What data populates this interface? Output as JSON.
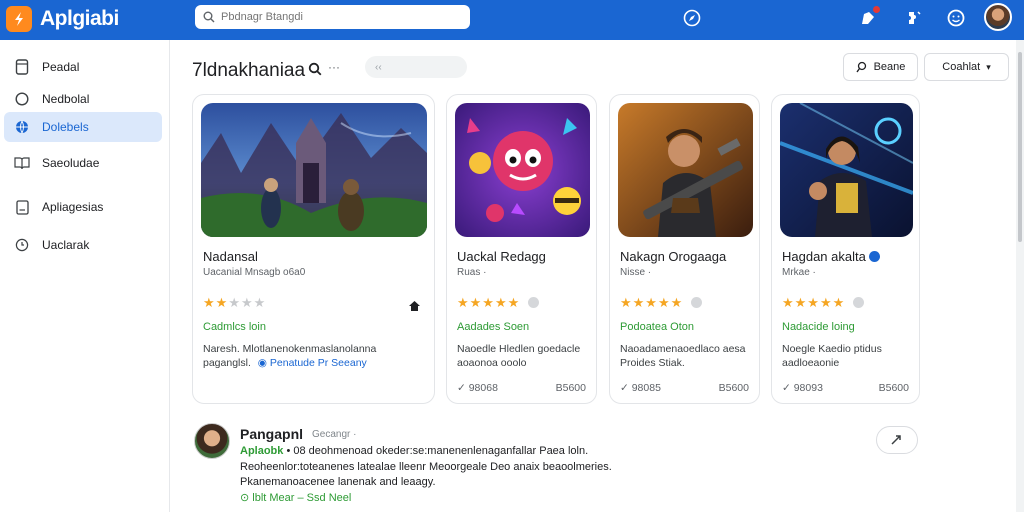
{
  "app": {
    "name": "Aplgiabi"
  },
  "search": {
    "placeholder": "Pbdnagr Btangdi"
  },
  "sidebar": {
    "items": [
      {
        "label": "Peadal",
        "icon": "tablet-icon",
        "active": false
      },
      {
        "label": "Nedbolal",
        "icon": "circle-icon",
        "active": false
      },
      {
        "label": "Dolebels",
        "icon": "globe-icon",
        "active": true
      },
      {
        "label": "Saeoludae",
        "icon": "book-icon",
        "active": false
      },
      {
        "label": "Apliagesias",
        "icon": "document-icon",
        "active": false
      },
      {
        "label": "Uaclarak",
        "icon": "clock-icon",
        "active": false
      }
    ]
  },
  "main": {
    "title": "7ldnakhaniaa",
    "more": "···",
    "filter_pill": "‹‹"
  },
  "actions": {
    "browse": "Beane",
    "download": "Coahlat"
  },
  "cards": [
    {
      "title": "Nadansal",
      "subtitle": "Uacanial Mnsagb o6a0",
      "rating": 2,
      "extra": "",
      "green": "Cadmlcs loin",
      "desc": "Naresh. Mlotlanenokenmaslanolanna paganglsl.",
      "tags": "Penatude Pr Seeany",
      "meta_left": "",
      "meta_right": ""
    },
    {
      "title": "Uackal Redagg",
      "subtitle": "Ruas ·",
      "rating": 5,
      "extra": "",
      "green": "Aadades Soen",
      "desc": "Naoedle Hledlen goedacle aoaonoa ooolo",
      "tags": "",
      "meta_left": "✓ 98068",
      "meta_right": "B5600"
    },
    {
      "title": "Nakagn Orogaaga",
      "subtitle": "Nisse ·",
      "rating": 5,
      "extra": "",
      "green": "Podoatea Oton",
      "desc": "Naoadamenaoedlaco aesa Proides Stiak.",
      "tags": "",
      "meta_left": "✓ 98085",
      "meta_right": "B5600"
    },
    {
      "title": "Hagdan akalta",
      "subtitle": "Mrkae ·",
      "rating": 5,
      "extra": "",
      "green": "Nadacide loing",
      "desc": "Noegle Kaedio ptidus aadloeaonie",
      "tags": "",
      "meta_left": "✓ 98093",
      "meta_right": "B5600"
    }
  ],
  "review": {
    "name": "Pangapnl",
    "date": "Gecangr ·",
    "green": "Aplaobk",
    "line1": "• 08 deohmenoad okeder:se:manenenlenaganfallar Paea loln.",
    "line2": "Reoheenlor:toteanenes latealae lleenr Meoorgeale Deo anaix beaoolmeries.",
    "line3": "Pkanemanoacenee lanenak and leaagy.",
    "line4": "⊙ lblt Mear – Ssd Neel"
  },
  "colors": {
    "accent": "#1a66d2",
    "brand": "#ff8a1e",
    "green": "#2e9b35",
    "star": "#f5a623"
  }
}
